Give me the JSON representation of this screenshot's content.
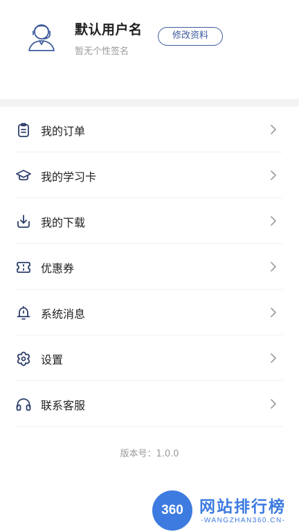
{
  "profile": {
    "username": "默认用户名",
    "signature": "暂无个性签名",
    "edit_button": "修改资料",
    "avatar_icon": "user-avatar-icon"
  },
  "menu": {
    "items": [
      {
        "label": "我的订单",
        "icon": "clipboard-icon"
      },
      {
        "label": "我的学习卡",
        "icon": "graduation-cap-icon"
      },
      {
        "label": "我的下载",
        "icon": "download-icon"
      },
      {
        "label": "优惠券",
        "icon": "ticket-icon"
      },
      {
        "label": "系统消息",
        "icon": "bell-icon"
      },
      {
        "label": "设置",
        "icon": "settings-icon"
      },
      {
        "label": "联系客服",
        "icon": "headset-icon"
      }
    ]
  },
  "version": "版本号：1.0.0",
  "watermark": {
    "badge": "360",
    "title": "网站排行榜",
    "url": "-WANGZHAN360.CN-"
  },
  "colors": {
    "accent": "#3d5a9c",
    "icon": "#2c3e6b",
    "muted_text": "#9a9a9a",
    "watermark": "#3d7be0"
  }
}
